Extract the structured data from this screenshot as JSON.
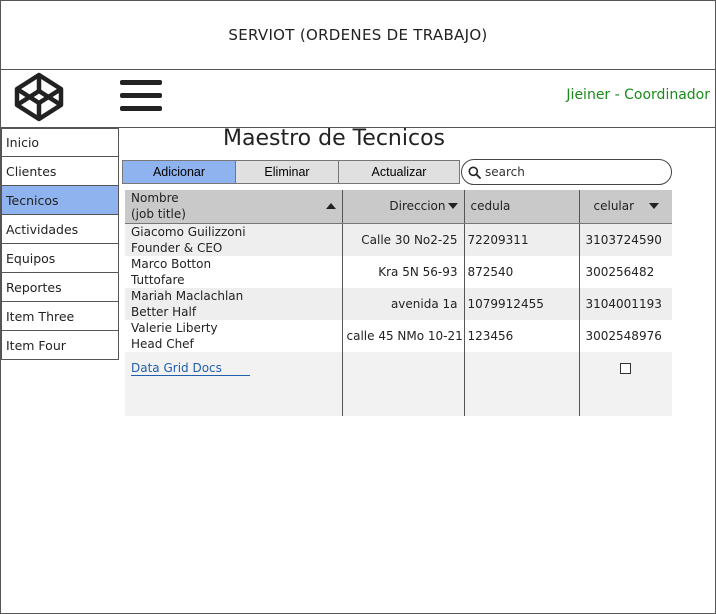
{
  "app": {
    "title": "SERVIOT (ORDENES DE TRABAJO)",
    "user_label": "Jieiner - Coordinador"
  },
  "icons": {
    "logo": "codepen-cube-logo-icon",
    "menu": "hamburger-menu-icon",
    "search": "search-icon",
    "sort_asc": "sort-up-icon",
    "sort_desc": "sort-down-icon"
  },
  "colors": {
    "active_nav": "#8fb3ef",
    "primary_button": "#8fb3ef",
    "user_label": "#1b8a1b",
    "link": "#1f5fae",
    "header_bg": "#c9c9c9"
  },
  "sidebar": {
    "items": [
      {
        "label": "Inicio",
        "active": false
      },
      {
        "label": "Clientes",
        "active": false
      },
      {
        "label": "Tecnicos",
        "active": true
      },
      {
        "label": "Actividades",
        "active": false
      },
      {
        "label": "Equipos",
        "active": false
      },
      {
        "label": "Reportes",
        "active": false
      },
      {
        "label": "Item Three",
        "active": false
      },
      {
        "label": "Item Four",
        "active": false
      }
    ]
  },
  "main": {
    "title": "Maestro de Tecnicos",
    "toolbar": {
      "add_label": "Adicionar",
      "delete_label": "Eliminar",
      "update_label": "Actualizar"
    },
    "search": {
      "placeholder": "search",
      "value": ""
    },
    "grid": {
      "columns": {
        "name_line1": "Nombre",
        "name_line2": "(job title)",
        "direccion": "Direccion",
        "cedula": "cedula",
        "celular": "celular"
      },
      "rows": [
        {
          "name": "Giacomo Guilizzoni",
          "title": "Founder & CEO",
          "direccion": "Calle 30 No2-25",
          "cedula": "72209311",
          "celular": "3103724590"
        },
        {
          "name": "Marco Botton",
          "title": "Tuttofare",
          "direccion": "Kra 5N 56-93",
          "cedula": "872540",
          "celular": "300256482"
        },
        {
          "name": "Mariah Maclachlan",
          "title": "Better Half",
          "direccion": "avenida 1a",
          "cedula": "1079912455",
          "celular": "3104001193"
        },
        {
          "name": "Valerie Liberty",
          "title": "Head Chef",
          "direccion": "calle 45 NMo 10-21",
          "cedula": "123456",
          "celular": "3002548976"
        }
      ],
      "footer_link": "Data Grid Docs"
    }
  }
}
